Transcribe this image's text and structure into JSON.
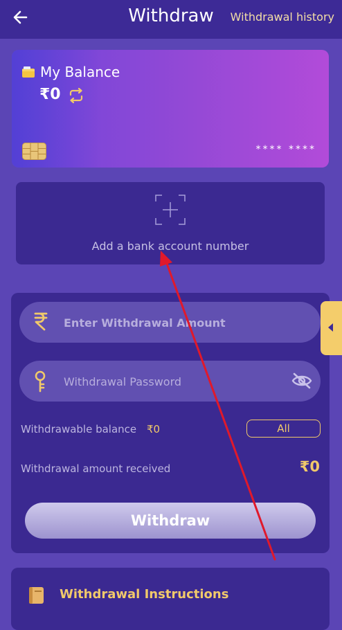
{
  "header": {
    "title": "Withdraw",
    "history_link": "Withdrawal history"
  },
  "balance_card": {
    "label": "My Balance",
    "amount": "₹0",
    "card_number_mask": "**** ****"
  },
  "bank": {
    "add_text": "Add a bank account number"
  },
  "form": {
    "amount_placeholder": "Enter Withdrawal Amount",
    "password_placeholder": "Withdrawal Password",
    "withdrawable_label": "Withdrawable balance",
    "withdrawable_value": "₹0",
    "all_button": "All",
    "received_label": "Withdrawal amount received",
    "received_value": "₹0",
    "submit_button": "Withdraw"
  },
  "instructions": {
    "title": "Withdrawal Instructions"
  },
  "colors": {
    "background": "#5b45b5",
    "header": "#3d2a96",
    "panel": "#3b2991",
    "gold": "#f1c96a",
    "annotation_arrow": "#e0192b"
  },
  "icons": [
    "back-arrow-icon",
    "wallet-icon",
    "refresh-icon",
    "chip-icon",
    "add-icon",
    "rupee-icon",
    "key-icon",
    "eye-off-icon",
    "chevron-left-icon",
    "book-icon"
  ]
}
